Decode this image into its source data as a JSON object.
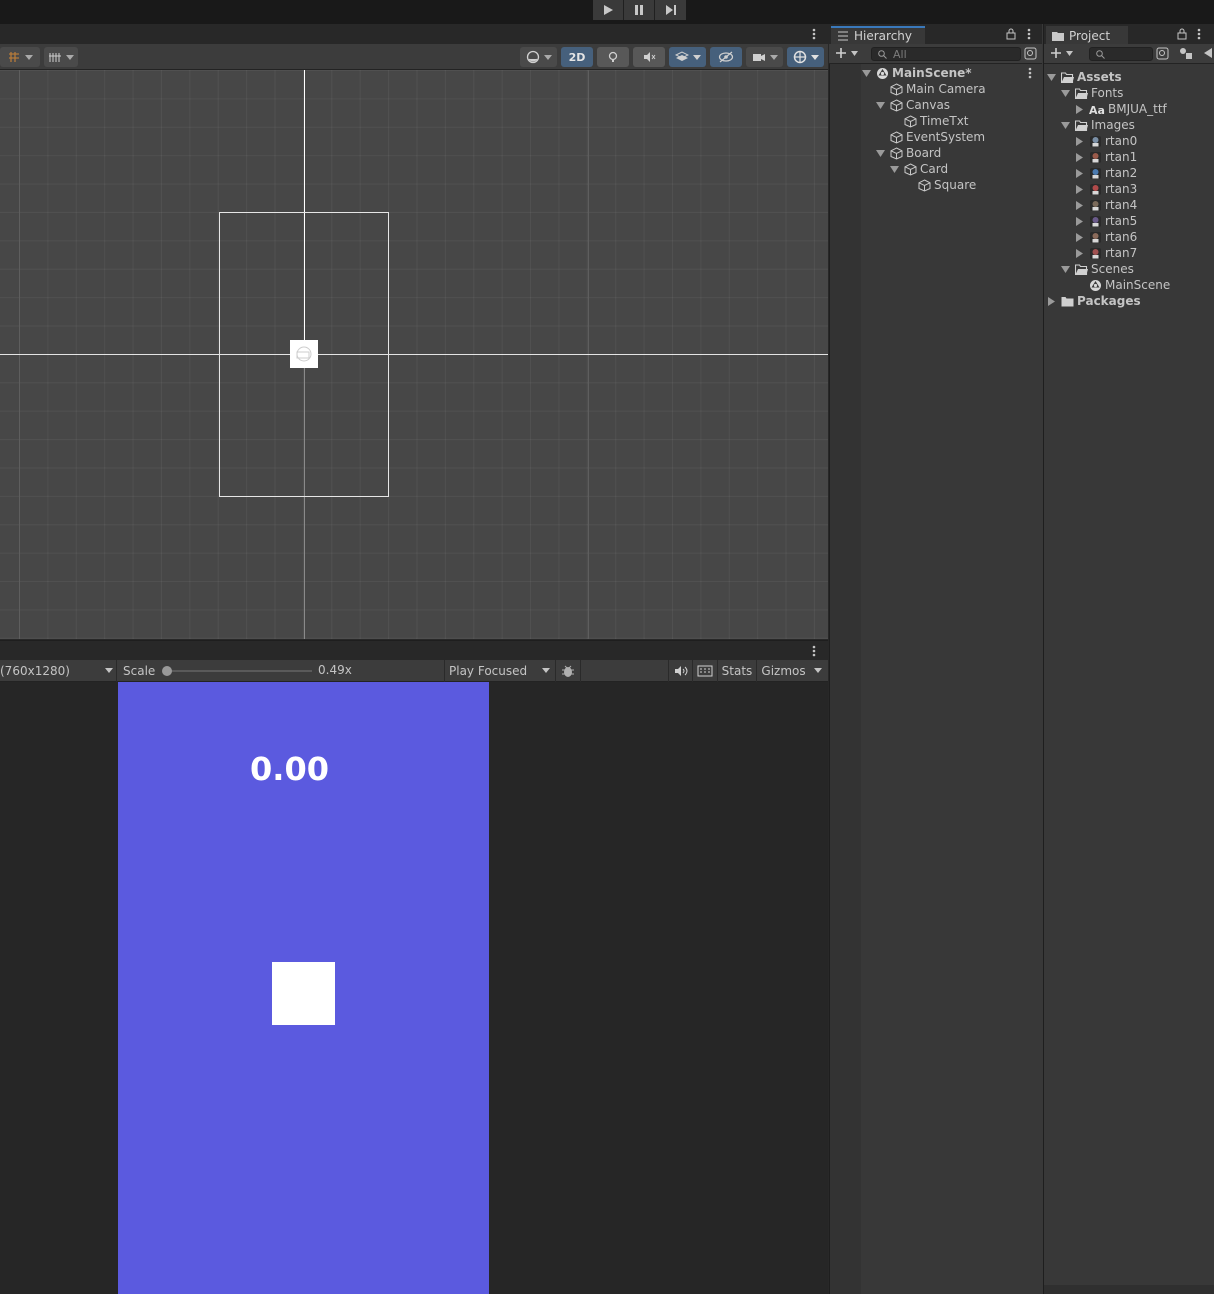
{
  "colors": {
    "accent": "#3a79bb",
    "game_background": "#5b5adf",
    "panel": "#383838",
    "scene_background": "#474747"
  },
  "playbar": {
    "buttons": [
      "play-icon",
      "pause-icon",
      "step-icon"
    ]
  },
  "scene_toolbar": {
    "mode_2d_label": "2D"
  },
  "game_toolbar": {
    "resolution": "(760x1280)",
    "scale_label": "Scale",
    "scale_value": "0.49x",
    "scale_fraction": 0.0,
    "play_mode": "Play Focused",
    "stats_label": "Stats",
    "gizmos_label": "Gizmos"
  },
  "game_view": {
    "timer_text": "0.00"
  },
  "hierarchy": {
    "tab_label": "Hierarchy",
    "search_placeholder": "All",
    "items": [
      {
        "label": "MainScene*",
        "depth": 0,
        "icon": "unity-scene-icon",
        "expanded": true,
        "bold": true
      },
      {
        "label": "Main Camera",
        "depth": 1,
        "icon": "gameobject-icon",
        "expanded": null,
        "bold": false
      },
      {
        "label": "Canvas",
        "depth": 1,
        "icon": "gameobject-icon",
        "expanded": true,
        "bold": false
      },
      {
        "label": "TimeTxt",
        "depth": 2,
        "icon": "gameobject-icon",
        "expanded": null,
        "bold": false
      },
      {
        "label": "EventSystem",
        "depth": 1,
        "icon": "gameobject-icon",
        "expanded": null,
        "bold": false
      },
      {
        "label": "Board",
        "depth": 1,
        "icon": "gameobject-icon",
        "expanded": true,
        "bold": false
      },
      {
        "label": "Card",
        "depth": 2,
        "icon": "gameobject-icon",
        "expanded": true,
        "bold": false
      },
      {
        "label": "Square",
        "depth": 3,
        "icon": "gameobject-icon",
        "expanded": null,
        "bold": false
      }
    ]
  },
  "project": {
    "tab_label": "Project",
    "tree": [
      {
        "label": "Assets",
        "depth": 0,
        "icon": "folder-open-icon",
        "expanded": true,
        "bold": true
      },
      {
        "label": "Fonts",
        "depth": 1,
        "icon": "folder-open-icon",
        "expanded": true,
        "bold": false
      },
      {
        "label": "BMJUA_ttf",
        "depth": 2,
        "icon": "font-icon",
        "icon_text": "Aa",
        "expanded": false,
        "bold": false
      },
      {
        "label": "Images",
        "depth": 1,
        "icon": "folder-open-icon",
        "expanded": true,
        "bold": false
      },
      {
        "label": "rtan0",
        "depth": 2,
        "icon": "sprite-icon",
        "icon_color": "#7a8fa6",
        "expanded": false,
        "bold": false
      },
      {
        "label": "rtan1",
        "depth": 2,
        "icon": "sprite-icon",
        "icon_color": "#9a5a4a",
        "expanded": false,
        "bold": false
      },
      {
        "label": "rtan2",
        "depth": 2,
        "icon": "sprite-icon",
        "icon_color": "#4a7ab0",
        "expanded": false,
        "bold": false
      },
      {
        "label": "rtan3",
        "depth": 2,
        "icon": "sprite-icon",
        "icon_color": "#b04a4a",
        "expanded": false,
        "bold": false
      },
      {
        "label": "rtan4",
        "depth": 2,
        "icon": "sprite-icon",
        "icon_color": "#7a6a5a",
        "expanded": false,
        "bold": false
      },
      {
        "label": "rtan5",
        "depth": 2,
        "icon": "sprite-icon",
        "icon_color": "#6a5a8a",
        "expanded": false,
        "bold": false
      },
      {
        "label": "rtan6",
        "depth": 2,
        "icon": "sprite-icon",
        "icon_color": "#8a6a5a",
        "expanded": false,
        "bold": false
      },
      {
        "label": "rtan7",
        "depth": 2,
        "icon": "sprite-icon",
        "icon_color": "#a05050",
        "expanded": false,
        "bold": false
      },
      {
        "label": "Scenes",
        "depth": 1,
        "icon": "folder-open-icon",
        "expanded": true,
        "bold": false
      },
      {
        "label": "MainScene",
        "depth": 2,
        "icon": "unity-scene-icon",
        "expanded": null,
        "bold": false
      },
      {
        "label": "Packages",
        "depth": 0,
        "icon": "folder-icon",
        "expanded": false,
        "bold": true
      }
    ]
  }
}
